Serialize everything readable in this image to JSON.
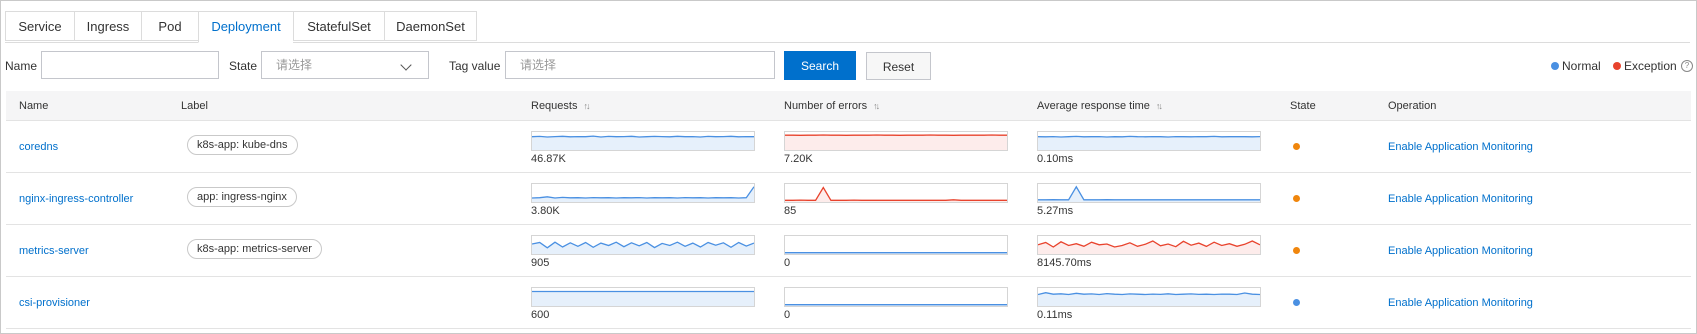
{
  "tabs": [
    "Service",
    "Ingress",
    "Pod",
    "Deployment",
    "StatefulSet",
    "DaemonSet"
  ],
  "active_tab": "Deployment",
  "filters": {
    "name_label": "Name",
    "name_value": "",
    "state_label": "State",
    "state_placeholder": "请选择",
    "tag_label": "Tag value",
    "tag_placeholder": "请选择",
    "search_label": "Search",
    "reset_label": "Reset"
  },
  "legend": {
    "normal_label": "Normal",
    "exception_label": "Exception",
    "normal_color": "#4a90e2",
    "exception_color": "#e8432d"
  },
  "columns": {
    "name": "Name",
    "label": "Label",
    "requests": "Requests",
    "errors": "Number of errors",
    "response": "Average response time",
    "state": "State",
    "operation": "Operation"
  },
  "colors": {
    "blue_line": "#4a90e2",
    "blue_fill": "#e6f0fb",
    "red_line": "#e8432d",
    "red_fill": "#fdeceb",
    "warning": "#f0860d",
    "link": "#0070cc",
    "primary": "#0070cc"
  },
  "rows": [
    {
      "name": "coredns",
      "label": "k8s-app: kube-dns",
      "requests": "46.87K",
      "errors": "7.20K",
      "response": "0.10ms",
      "state": "exception-warning",
      "operation": "Enable Application Monitoring",
      "spark_requests": {
        "color": "blue",
        "values": [
          0.82,
          0.84,
          0.8,
          0.83,
          0.85,
          0.81,
          0.83,
          0.82,
          0.86,
          0.8,
          0.84,
          0.82,
          0.83,
          0.85,
          0.8,
          0.82,
          0.84,
          0.83,
          0.81,
          0.85,
          0.82,
          0.83,
          0.8,
          0.84,
          0.82,
          0.83,
          0.85,
          0.81,
          0.83,
          0.82
        ]
      },
      "spark_errors": {
        "color": "red",
        "values": [
          0.92,
          0.92,
          0.91,
          0.92,
          0.92,
          0.93,
          0.92,
          0.92,
          0.91,
          0.92,
          0.92,
          0.92,
          0.93,
          0.92,
          0.92,
          0.91,
          0.92,
          0.92,
          0.92,
          0.93,
          0.92,
          0.92,
          0.91,
          0.92,
          0.92,
          0.92,
          0.92,
          0.93,
          0.92,
          0.92
        ]
      },
      "spark_response": {
        "color": "blue",
        "values": [
          0.82,
          0.81,
          0.83,
          0.8,
          0.82,
          0.84,
          0.81,
          0.82,
          0.83,
          0.8,
          0.82,
          0.81,
          0.84,
          0.82,
          0.81,
          0.83,
          0.82,
          0.8,
          0.83,
          0.82,
          0.81,
          0.83,
          0.82,
          0.84,
          0.81,
          0.82,
          0.83,
          0.82,
          0.81,
          0.83
        ]
      }
    },
    {
      "name": "nginx-ingress-controller",
      "label": "app: ingress-nginx",
      "requests": "3.80K",
      "errors": "85",
      "response": "5.27ms",
      "state": "exception-warning",
      "operation": "Enable Application Monitoring",
      "spark_requests": {
        "color": "blue",
        "values": [
          0.2,
          0.22,
          0.28,
          0.2,
          0.24,
          0.21,
          0.22,
          0.2,
          0.23,
          0.21,
          0.22,
          0.2,
          0.22,
          0.21,
          0.23,
          0.2,
          0.22,
          0.21,
          0.22,
          0.2,
          0.23,
          0.21,
          0.22,
          0.2,
          0.22,
          0.21,
          0.22,
          0.2,
          0.22,
          0.95
        ]
      },
      "spark_errors": {
        "color": "red",
        "values": [
          0.05,
          0.05,
          0.06,
          0.05,
          0.05,
          0.9,
          0.05,
          0.05,
          0.05,
          0.06,
          0.05,
          0.05,
          0.05,
          0.05,
          0.05,
          0.05,
          0.05,
          0.05,
          0.05,
          0.05,
          0.05,
          0.05,
          0.08,
          0.05,
          0.05,
          0.05,
          0.05,
          0.05,
          0.05,
          0.05
        ]
      },
      "spark_response": {
        "color": "blue",
        "values": [
          0.08,
          0.08,
          0.09,
          0.08,
          0.08,
          0.95,
          0.08,
          0.08,
          0.08,
          0.09,
          0.08,
          0.08,
          0.08,
          0.08,
          0.08,
          0.08,
          0.08,
          0.08,
          0.08,
          0.08,
          0.08,
          0.08,
          0.08,
          0.08,
          0.08,
          0.08,
          0.08,
          0.08,
          0.08,
          0.08
        ]
      }
    },
    {
      "name": "metrics-server",
      "label": "k8s-app: metrics-server",
      "requests": "905",
      "errors": "0",
      "response": "8145.70ms",
      "state": "exception-warning",
      "operation": "Enable Application Monitoring",
      "spark_requests": {
        "color": "blue",
        "values": [
          0.6,
          0.7,
          0.35,
          0.72,
          0.4,
          0.68,
          0.45,
          0.7,
          0.38,
          0.66,
          0.5,
          0.72,
          0.42,
          0.68,
          0.48,
          0.7,
          0.36,
          0.64,
          0.5,
          0.72,
          0.45,
          0.66,
          0.4,
          0.7,
          0.52,
          0.68,
          0.38,
          0.7,
          0.46,
          0.66
        ]
      },
      "spark_errors": {
        "color": "blue",
        "values": [
          0.02,
          0.02,
          0.02,
          0.02,
          0.02,
          0.02,
          0.02,
          0.02,
          0.02,
          0.02,
          0.02,
          0.02,
          0.02,
          0.02,
          0.02,
          0.02,
          0.02,
          0.02,
          0.02,
          0.02,
          0.02,
          0.02,
          0.02,
          0.02,
          0.02,
          0.02,
          0.02,
          0.02,
          0.02,
          0.02
        ]
      },
      "spark_response": {
        "color": "red",
        "values": [
          0.55,
          0.7,
          0.4,
          0.75,
          0.5,
          0.62,
          0.45,
          0.72,
          0.55,
          0.6,
          0.4,
          0.5,
          0.68,
          0.45,
          0.58,
          0.8,
          0.48,
          0.6,
          0.42,
          0.78,
          0.52,
          0.66,
          0.44,
          0.72,
          0.5,
          0.62,
          0.45,
          0.58,
          0.8,
          0.55
        ]
      }
    },
    {
      "name": "csi-provisioner",
      "label": "",
      "requests": "600",
      "errors": "0",
      "response": "0.11ms",
      "state": "normal",
      "operation": "Enable Application Monitoring",
      "spark_requests": {
        "color": "blue",
        "values": [
          0.9,
          0.9,
          0.9,
          0.9,
          0.9,
          0.9,
          0.9,
          0.9,
          0.9,
          0.9,
          0.9,
          0.9,
          0.9,
          0.9,
          0.9,
          0.9,
          0.9,
          0.9,
          0.9,
          0.9,
          0.9,
          0.9,
          0.9,
          0.9,
          0.9,
          0.9,
          0.9,
          0.9,
          0.9,
          0.9
        ]
      },
      "spark_errors": {
        "color": "blue",
        "values": [
          0.02,
          0.02,
          0.02,
          0.02,
          0.02,
          0.02,
          0.02,
          0.02,
          0.02,
          0.02,
          0.02,
          0.02,
          0.02,
          0.02,
          0.02,
          0.02,
          0.02,
          0.02,
          0.02,
          0.02,
          0.02,
          0.02,
          0.02,
          0.02,
          0.02,
          0.02,
          0.02,
          0.02,
          0.02,
          0.02
        ]
      },
      "spark_response": {
        "color": "blue",
        "values": [
          0.7,
          0.82,
          0.72,
          0.75,
          0.7,
          0.78,
          0.72,
          0.74,
          0.7,
          0.76,
          0.72,
          0.7,
          0.74,
          0.72,
          0.7,
          0.73,
          0.71,
          0.75,
          0.7,
          0.72,
          0.74,
          0.71,
          0.72,
          0.7,
          0.73,
          0.72,
          0.7,
          0.8,
          0.72,
          0.7
        ]
      }
    }
  ]
}
